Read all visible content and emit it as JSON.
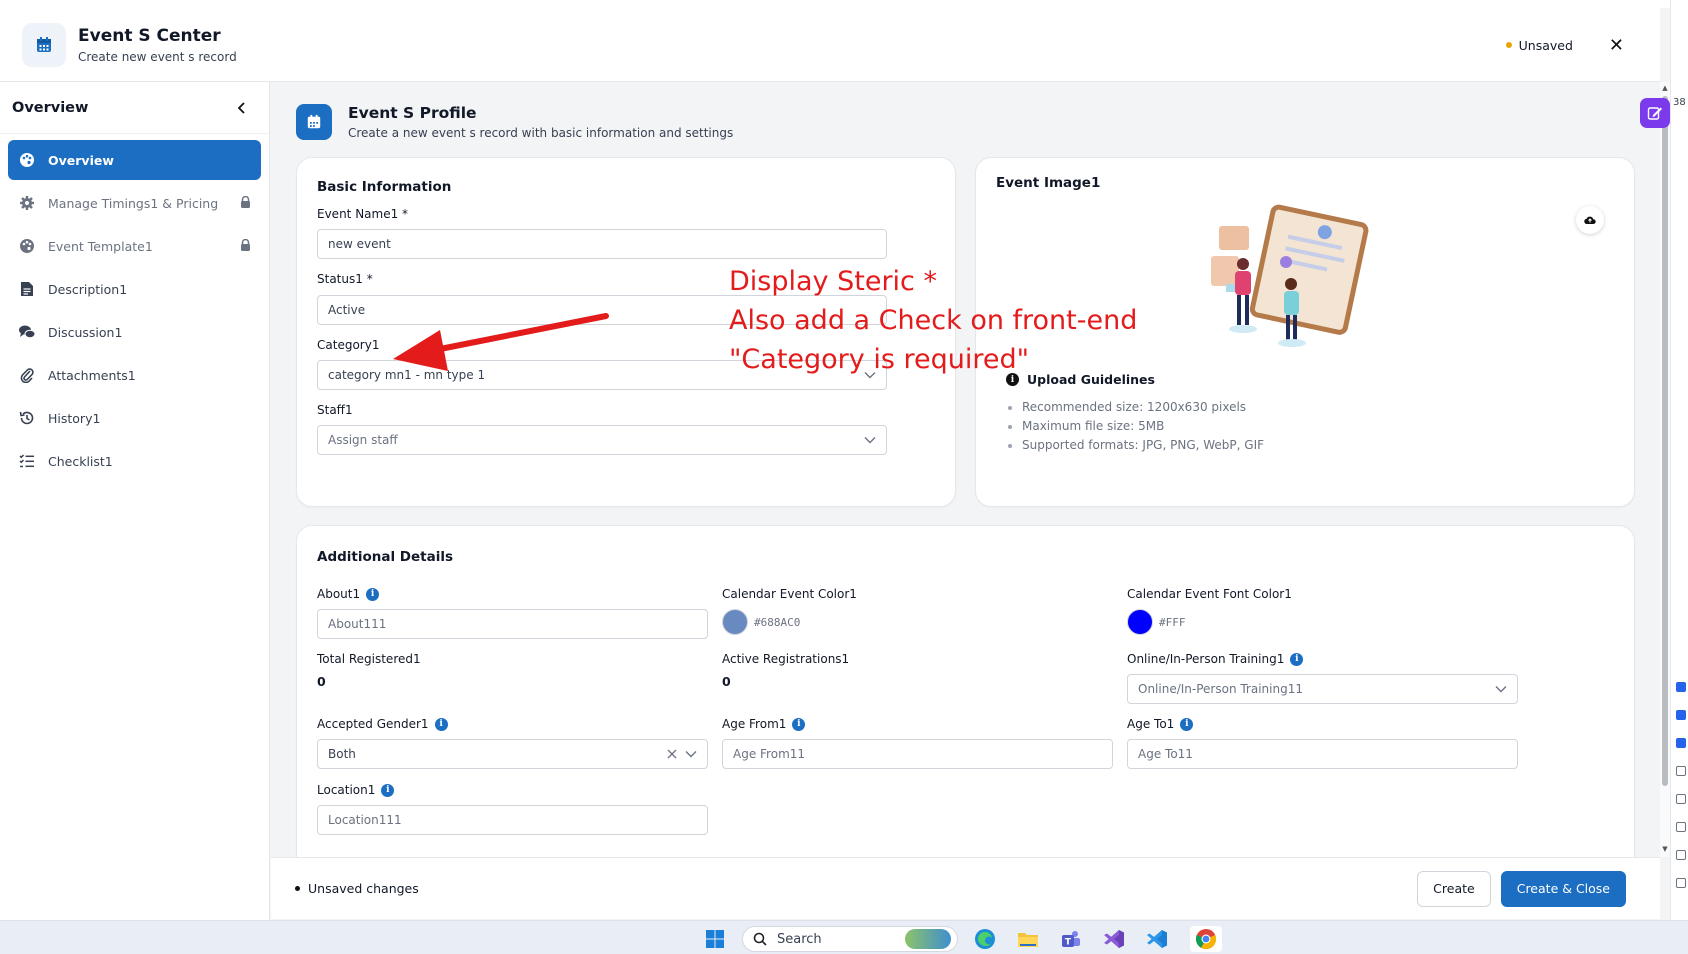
{
  "header": {
    "title": "Event S Center",
    "subtitle": "Create new event s record",
    "unsaved_label": "Unsaved",
    "close_glyph": "✕"
  },
  "sidebar": {
    "title": "Overview",
    "items": [
      {
        "label": "Overview",
        "icon": "palette-icon",
        "active": true,
        "locked": false
      },
      {
        "label": "Manage Timings1 & Pricing",
        "icon": "gear-icon",
        "active": false,
        "locked": true
      },
      {
        "label": "Event Template1",
        "icon": "palette-icon",
        "active": false,
        "locked": true
      },
      {
        "label": "Description1",
        "icon": "document-icon",
        "active": false,
        "locked": false
      },
      {
        "label": "Discussion1",
        "icon": "chat-icon",
        "active": false,
        "locked": false
      },
      {
        "label": "Attachments1",
        "icon": "paperclip-icon",
        "active": false,
        "locked": false
      },
      {
        "label": "History1",
        "icon": "history-icon",
        "active": false,
        "locked": false
      },
      {
        "label": "Checklist1",
        "icon": "checklist-icon",
        "active": false,
        "locked": false
      }
    ]
  },
  "profile": {
    "title": "Event S Profile",
    "subtitle": "Create a new event s record with basic information and settings"
  },
  "basic": {
    "title": "Basic Information",
    "event_name_label": "Event Name1 *",
    "event_name_value": "new event",
    "status_label": "Status1 *",
    "status_value": "Active",
    "category_label": "Category1",
    "category_value": "category mn1 - mn type 1",
    "staff_label": "Staff1",
    "staff_placeholder": "Assign staff"
  },
  "image": {
    "title": "Event Image1",
    "guidelines_title": "Upload Guidelines",
    "guidelines": [
      "Recommended size: 1200x630 pixels",
      "Maximum file size: 5MB",
      "Supported formats: JPG, PNG, WebP, GIF"
    ]
  },
  "additional": {
    "title": "Additional Details",
    "about_label": "About1",
    "about_placeholder": "About111",
    "cal_color_label": "Calendar Event Color1",
    "cal_color_value": "#688AC0",
    "cal_font_color_label": "Calendar Event Font Color1",
    "cal_font_color_value": "#FFF",
    "total_registered_label": "Total Registered1",
    "total_registered_value": "0",
    "active_registrations_label": "Active Registrations1",
    "active_registrations_value": "0",
    "training_label": "Online/In-Person Training1",
    "training_placeholder": "Online/In-Person Training11",
    "gender_label": "Accepted Gender1",
    "gender_value": "Both",
    "age_from_label": "Age From1",
    "age_from_placeholder": "Age From11",
    "age_to_label": "Age To1",
    "age_to_placeholder": "Age To11",
    "location_label": "Location1",
    "location_placeholder": "Location111"
  },
  "footer": {
    "status": "Unsaved changes",
    "create_label": "Create",
    "create_close_label": "Create & Close"
  },
  "annotation": {
    "line1": "Display Steric *",
    "line2": "Also add a Check on front-end",
    "line3": "\"Category is required\""
  },
  "taskbar": {
    "search_label": "Search"
  },
  "right_panel": {
    "number": "38"
  },
  "colors": {
    "primary": "#1b6ec2",
    "swatch_event": "#688ac0",
    "swatch_font": "#0000ff",
    "annotation": "#e41b1b",
    "unsaved_dot": "#e5a50a"
  }
}
